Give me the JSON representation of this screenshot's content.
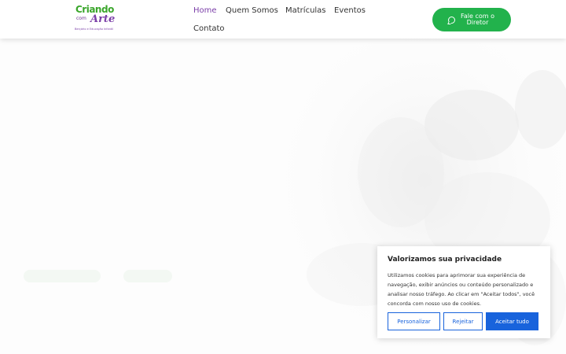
{
  "brand": {
    "line1": "Criando",
    "line2": "com",
    "line3": "Arte",
    "tagline": "Berçário e Educação Infantil"
  },
  "nav": {
    "items": [
      "Home",
      "Quem Somos",
      "Matrículas",
      "Eventos",
      "Contato"
    ],
    "active": "Home"
  },
  "cta": {
    "label": "Fale com o Diretor",
    "icon": "whatsapp-icon"
  },
  "colors": {
    "brand_green": "#22b24c",
    "brand_purple": "#7b3fa8",
    "cookie_blue": "#1863dc"
  },
  "cookie": {
    "title": "Valorizamos sua privacidade",
    "text": "Utilizamos cookies para aprimorar sua experiência de navegação, exibir anúncios ou conteúdo personalizado e analisar nosso tráfego. Ao clicar em \"Aceitar todos\", você concorda com nosso uso de cookies.",
    "customize_label": "Personalizar",
    "reject_label": "Rejeitar",
    "accept_label": "Aceitar tudo"
  }
}
